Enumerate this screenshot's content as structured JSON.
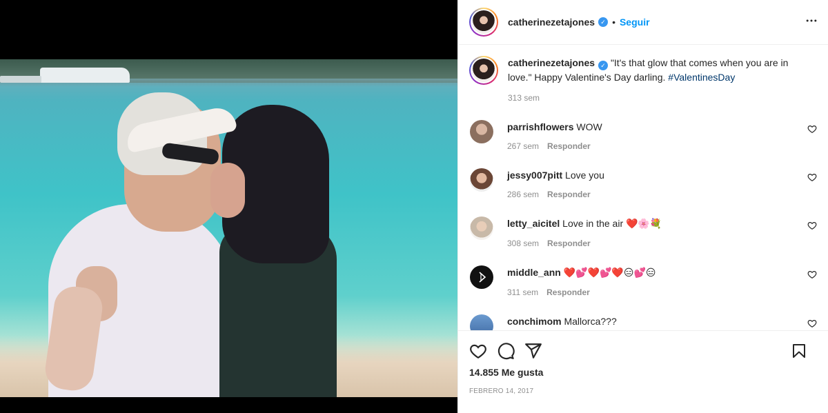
{
  "post": {
    "username": "catherinezetajones",
    "follow_label": "Seguir",
    "dot": "•",
    "more_label": "•••",
    "verified_mark": "✓",
    "caption": {
      "username": "catherinezetajones",
      "text": " \"It's that glow that comes when you are in love.\" Happy Valentine's Day darling. ",
      "hashtag": "#ValentinesDay",
      "time": "313 sem"
    },
    "comments": [
      {
        "username": "parrishflowers",
        "text": " WOW",
        "time": "267 sem",
        "reply": "Responder",
        "avatar_color": "#9c8c7d"
      },
      {
        "username": "jessy007pitt",
        "text": " Love you",
        "time": "286 sem",
        "reply": "Responder",
        "avatar_color": "#b7846c"
      },
      {
        "username": "letty_aicitel",
        "text": " Love in the air ",
        "emojis": "❤️🌸💐",
        "time": "308 sem",
        "reply": "Responder",
        "avatar_color": "#cfc6bd"
      },
      {
        "username": "middle_ann",
        "text": " ",
        "emojis": "❤️💕❤️💕❤️😑💕😑",
        "time": "311 sem",
        "reply": "Responder",
        "avatar_color": "#111111"
      },
      {
        "username": "conchimom",
        "text": " Mallorca???",
        "time": "",
        "reply": "",
        "avatar_color": "#5c86b7"
      }
    ],
    "likes": "14.855 Me gusta",
    "date": "Febrero 14, 2017",
    "icons": [
      "heart-icon",
      "comment-icon",
      "share-icon",
      "bookmark-icon",
      "more-icon",
      "verified-icon"
    ]
  }
}
